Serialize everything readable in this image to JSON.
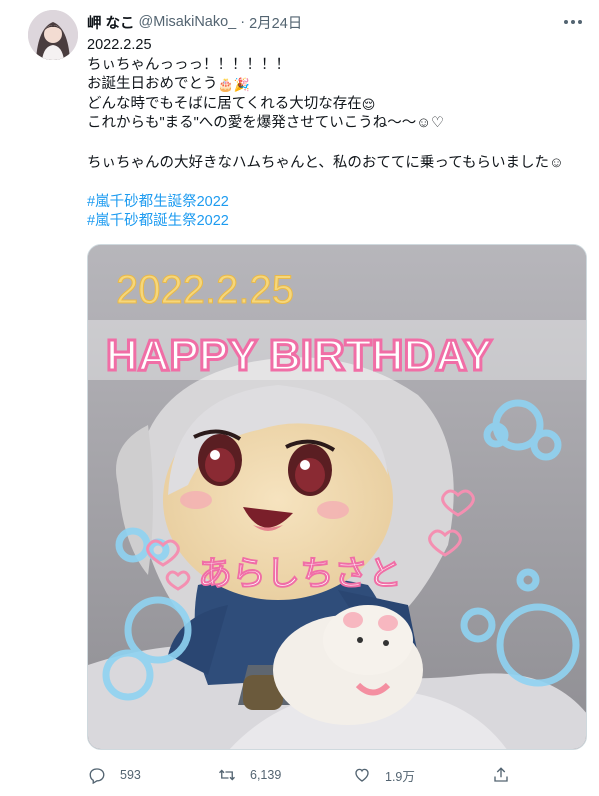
{
  "user": {
    "display_name": "岬 なこ",
    "handle": "@MisakiNako_",
    "separator": "·",
    "date": "2月24日"
  },
  "tweet": {
    "lines": [
      "2022.2.25",
      "ちぃちゃんっっっ！！！！！！",
      "お誕生日おめでとう",
      "どんな時でもそばに居てくれる大切な存在",
      "これからも\"まる\"への愛を爆発させていこうね〜〜☺︎♡",
      "ちぃちゃんの大好きなハムちゃんと、私のおててに乗ってもらいました☺︎"
    ],
    "emoji_birthday": "🎂🎉",
    "emoji_relieved": "😌",
    "hashtags": [
      "#嵐千砂都生誕祭2022",
      "#嵐千砂都誕生祭2022"
    ]
  },
  "media": {
    "overlay_date": "2022.2.25",
    "overlay_title": "HAPPY BIRTHDAY",
    "overlay_name": "あらしちさと"
  },
  "actions": {
    "reply_count": "593",
    "retweet_count": "6,139",
    "like_count": "1.9万"
  },
  "colors": {
    "accent": "#1d9bf0",
    "secondary_text": "#536471",
    "primary_text": "#0f1419"
  },
  "icons": [
    "more-icon",
    "reply-icon",
    "retweet-icon",
    "like-icon",
    "share-icon"
  ]
}
